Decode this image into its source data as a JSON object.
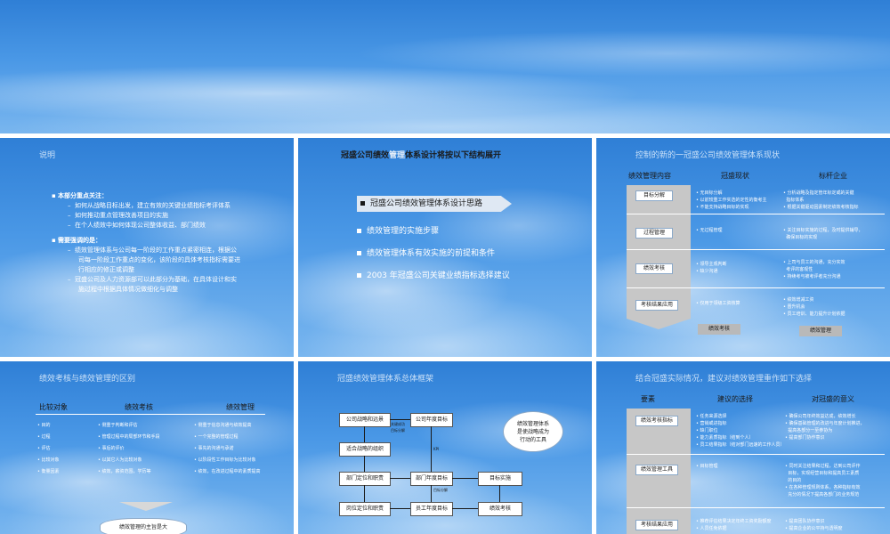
{
  "slide1": {
    "title": "说明",
    "b1": "本部分重点关注：",
    "b1_items": [
      "如何从战略目标出发，建立有效的关键业绩指标考评体系",
      "如何推动重点管理改善项目的实施",
      "在个人绩效中如何体现公司整体收益、部门绩效"
    ],
    "b2": "需要强调的是：",
    "b2_items": [
      "绩效管理体系与公司每一阶段的工作重点紧密相连，根据公",
      "司每一阶段工作重点的变化，该阶段的具体考核指标需要进",
      "行相应的修正或调整",
      "冠盛公司及人力资源部可以此部分为基础，在具体设计和实",
      "施过程中根据具体情况做细化与调整"
    ]
  },
  "slide2": {
    "title_a": "冠盛公司绩效",
    "title_b": "管理",
    "title_c": "体系设计将按以下结构展开",
    "items": [
      "冠盛公司绩效管理体系设计思路",
      "绩效管理的实施步骤",
      "绩效管理体系有效实施的前提和条件",
      "2003 年冠盛公司关键业绩指标选择建议"
    ]
  },
  "slide3": {
    "title": "控制的新的一冠盛公司绩效管理体系现状",
    "col1": "绩效管理内容",
    "col2": "冠盛现状",
    "col3": "标杆企业",
    "rows": [
      "目标分解",
      "过程管理",
      "绩效考核",
      "考核结果应用"
    ],
    "now": [
      [
        "无目标分解",
        "以前较重工作实选的定性的衡考主",
        "不能支持战略目标的实现"
      ],
      [
        "无过程管理"
      ],
      [
        "领导主观判断",
        "缺少沟通"
      ],
      [
        "仅用于领级工资核算"
      ]
    ],
    "bench": [
      [
        "分析战略及指定管年标定或的关键",
        "指标体系",
        "根据关键驱动因素制定绩效考核指标"
      ],
      [
        "关注目标实施的过程，及时提供辅导，",
        "确保目标的实现"
      ],
      [
        "上司与员工的沟通，充分实效",
        "考评的客观性",
        "持续考与被考评者充分沟通"
      ],
      [
        "绩效增减工资",
        "晋升机会",
        "员工培训、能力提升计划依据"
      ]
    ],
    "btn1": "绩效考核",
    "btn2": "绩效管理"
  },
  "slide4": {
    "title": "绩效考核与绩效管理的区别",
    "h1": "比较对象",
    "h2": "绩效考核",
    "h3": "绩效管理",
    "c1": [
      "目的",
      "过程",
      "评估",
      "比较对象",
      "衡量因素"
    ],
    "c2": [
      "侧重于判断和评估",
      "管理过程中的局部环节和手段",
      "事后的评价",
      "以其它人为比较对象",
      "绩效，薪资范围，学历等"
    ],
    "c3": [
      "侧重于信息沟通与绩效提高",
      "一个完整的管理过程",
      "事先的沟通与承诺",
      "以阶段性工作目标为比较对象",
      "绩效，在改进过程中的素质提高"
    ],
    "note": "绩效管理的主旨是大"
  },
  "slide5": {
    "title": "冠盛绩效管理体系总体框架",
    "b_strategy": "公司战略和远景",
    "b_annual": "公司年度目标",
    "b_org": "适合战略的组织",
    "b_dept": "部门定位和职责",
    "b_dept_goal": "部门年度目标",
    "b_exec": "目标实施",
    "b_pos": "岗位定位和职责",
    "b_emp": "员工年度目标",
    "b_eval": "绩效考核",
    "lbl1": "关键成功",
    "lbl2": "目标分解",
    "lbl3": "目标分解",
    "lbl4": "KPI",
    "cloud": "绩效管理体系\n是使战略成为\n行动的工具"
  },
  "slide6": {
    "title": "结合冠盛实际情况，建议对绩效管理重作如下选择",
    "h1": "要素",
    "h2": "建议的选择",
    "h3": "对冠盛的意义",
    "rows": [
      "绩效考核指标",
      "绩效管理工具",
      "考核结果应用"
    ],
    "sug": [
      [
        "任务来源选择",
        "营销或进指标",
        "缺门职位",
        "能力素质指标（结到个人）",
        "员工结果指标（结对部门远速的工作人员）"
      ],
      [
        "目标管理"
      ],
      [
        "推荐评估结果决定年终工资奖励额度",
        "人员任免依据"
      ]
    ],
    "mean": [
      [
        "确保公司年终效益达成，绩效增长",
        "确保基础管理的改进与年度计划推进，",
        "提高各部分一至参协为",
        "提高部门协作意识"
      ],
      [
        "同时关注结果和过程，达到公司评作",
        "目标，实现经营目标和提高员工素质",
        "的目的",
        "在各种管理规则体系，各种指标有效",
        "充分的情况下提高各部门的业务规范"
      ],
      [
        "提高团队协作意识",
        "提高企业的公平持与透明度"
      ]
    ]
  }
}
